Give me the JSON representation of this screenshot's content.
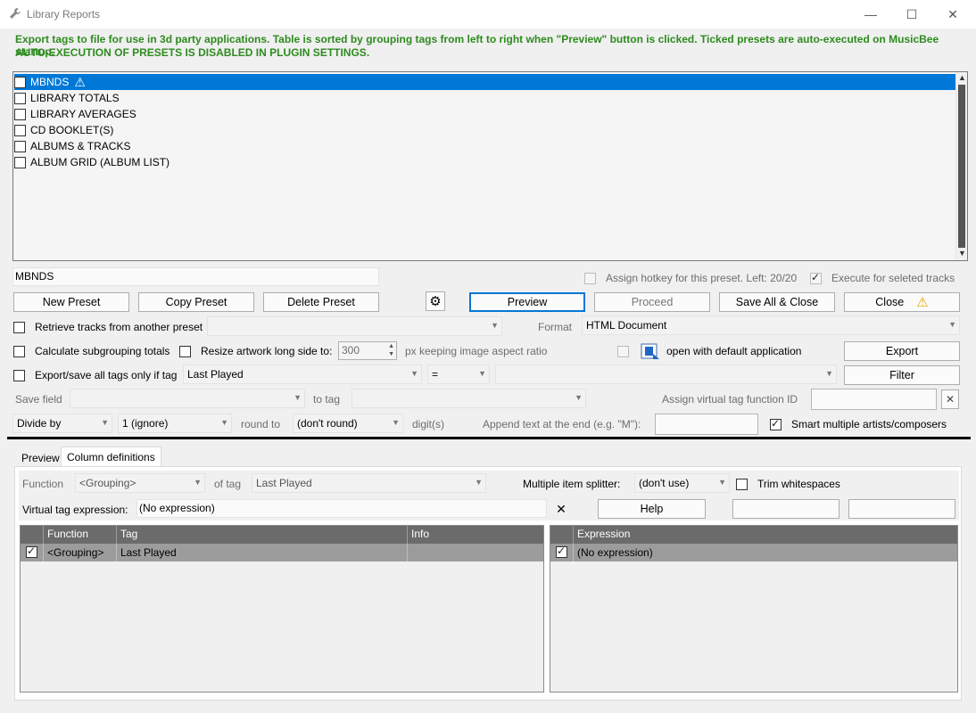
{
  "window": {
    "title": "Library Reports",
    "wrench_icon": "wrench-icon",
    "controls": {
      "minimize": "—",
      "maximize": "☐",
      "close": "✕"
    }
  },
  "info": {
    "line1": "Export tags to file for use in 3d party applications. Table is sorted by grouping tags from left to right when \"Preview\" button is clicked. Ticked presets are auto-executed on MusicBee startup.",
    "line2": "AUTO-EXECUTION OF PRESETS IS DISABLED IN PLUGIN SETTINGS.",
    "color": "#2e8b1f"
  },
  "presets": [
    {
      "label": "MBNDS",
      "selected": true,
      "warning_icon": "⚠"
    },
    {
      "label": "LIBRARY TOTALS"
    },
    {
      "label": "LIBRARY AVERAGES"
    },
    {
      "label": "CD BOOKLET(S)"
    },
    {
      "label": "ALBUMS & TRACKS"
    },
    {
      "label": "ALBUM GRID (ALBUM LIST)"
    }
  ],
  "preset_name": "MBNDS",
  "hotkey_label": "Assign hotkey for this preset. Left: 20/20",
  "execute_selected_label": "Execute for seleted tracks",
  "buttons": {
    "new_preset": "New Preset",
    "copy_preset": "Copy Preset",
    "delete_preset": "Delete Preset",
    "settings_icon": "⚙",
    "preview": "Preview",
    "proceed": "Proceed",
    "save_all_close": "Save All & Close",
    "close": "Close",
    "close_warning": "⚠",
    "export": "Export",
    "filter": "Filter",
    "clear_function_id": "✕"
  },
  "options": {
    "retrieve_label": "Retrieve tracks from another preset",
    "retrieve_value": "",
    "format_label": "Format",
    "format_value": "HTML Document",
    "calc_subgroup_label": "Calculate subgrouping totals",
    "resize_label": "Resize artwork long side to:",
    "resize_value": "300",
    "aspect_label": "px keeping image aspect ratio",
    "open_default_label": "open with default application",
    "export_only_label": "Export/save all tags only if tag",
    "export_only_tag": "Last Played",
    "export_only_op": "=",
    "export_only_value": "",
    "save_field_label": "Save field",
    "save_field_value": "",
    "to_tag_label": "to tag",
    "to_tag_value": "",
    "assign_virtual_label": "Assign virtual tag function ID",
    "assign_virtual_value": "",
    "divide_by": "Divide by",
    "divide_value": "1 (ignore)",
    "round_to_label": "round to",
    "round_value": "(don't round)",
    "digits_label": "digit(s)",
    "append_label": "Append text at the end (e.g. \"M\"):",
    "append_value": "",
    "smart_label": "Smart multiple artists/composers"
  },
  "tabs": [
    {
      "label": "Preview"
    },
    {
      "label": "Column definitions",
      "active": true
    }
  ],
  "coldef": {
    "function_label": "Function",
    "function_value": "<Grouping>",
    "of_tag_label": "of tag",
    "of_tag_value": "Last Played",
    "splitter_label": "Multiple item splitter:",
    "splitter_value": "(don't use)",
    "trim_label": "Trim whitespaces",
    "vtag_label": "Virtual tag expression:",
    "vtag_value": "(No expression)",
    "help": "Help"
  },
  "left_grid": {
    "headers": [
      "",
      "Function",
      "Tag",
      "Info"
    ],
    "rows": [
      {
        "function": "<Grouping>",
        "tag": "Last Played",
        "info": ""
      }
    ]
  },
  "right_grid": {
    "headers": [
      "",
      "Expression"
    ],
    "rows": [
      {
        "expression": "(No expression)"
      }
    ]
  }
}
